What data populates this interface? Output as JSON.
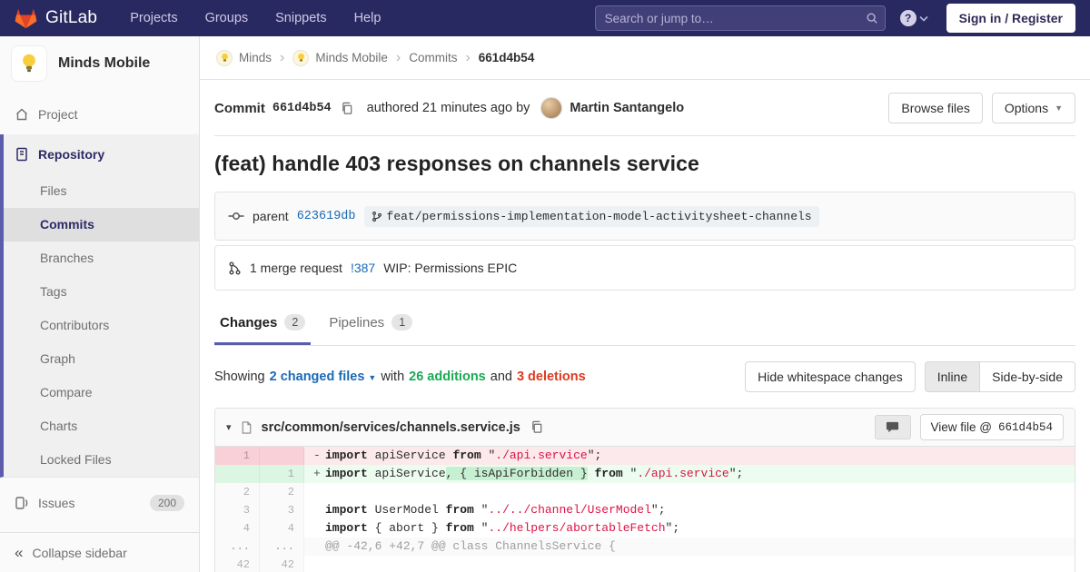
{
  "colors": {
    "navbar_bg": "#292961",
    "logo_orange": "#fc6d26",
    "logo_red": "#e24329",
    "logo_yellow": "#fca326",
    "link_blue": "#1b69b6",
    "additions_green": "#1aaa55",
    "deletions_red": "#db3b21",
    "active_indigo": "#5c5cac",
    "diff_string_red": "#d14",
    "removed_bg": "#fbe9eb",
    "added_bg": "#ecfdf0"
  },
  "navbar": {
    "logo_text": "GitLab",
    "menu": [
      {
        "label": "Projects"
      },
      {
        "label": "Groups"
      },
      {
        "label": "Snippets"
      },
      {
        "label": "Help"
      }
    ],
    "search_placeholder": "Search or jump to…",
    "signin_label": "Sign in / Register"
  },
  "sidebar": {
    "project_name": "Minds Mobile",
    "project_item": "Project",
    "repository_item": "Repository",
    "repository_subitems": [
      {
        "label": "Files"
      },
      {
        "label": "Commits"
      },
      {
        "label": "Branches"
      },
      {
        "label": "Tags"
      },
      {
        "label": "Contributors"
      },
      {
        "label": "Graph"
      },
      {
        "label": "Compare"
      },
      {
        "label": "Charts"
      },
      {
        "label": "Locked Files"
      }
    ],
    "issues_label": "Issues",
    "issues_count": "200",
    "collapse_label": "Collapse sidebar"
  },
  "breadcrumb": {
    "items": [
      {
        "label": "Minds"
      },
      {
        "label": "Minds Mobile"
      },
      {
        "label": "Commits"
      }
    ],
    "current": "661d4b54"
  },
  "commit": {
    "label": "Commit",
    "sha": "661d4b54",
    "authored_text": "authored 21 minutes ago by",
    "author": "Martin Santangelo",
    "browse_files_label": "Browse files",
    "options_label": "Options",
    "title": "(feat) handle 403 responses on channels service",
    "parent_label": "parent",
    "parent_sha": "623619db",
    "parent_branch": "feat/permissions-implementation-model-activitysheet-channels",
    "mr_count_text": "1 merge request",
    "mr_ref": "!387",
    "mr_title": "WIP: Permissions EPIC"
  },
  "tabs": [
    {
      "label": "Changes",
      "count": "2"
    },
    {
      "label": "Pipelines",
      "count": "1"
    }
  ],
  "changes_bar": {
    "showing": "Showing",
    "files_link": "2 changed files",
    "with_word": "with",
    "additions": "26 additions",
    "and_word": "and",
    "deletions": "3 deletions",
    "hide_whitespace_label": "Hide whitespace changes",
    "inline_label": "Inline",
    "side_by_side_label": "Side-by-side"
  },
  "file": {
    "path": "src/common/services/channels.service.js",
    "view_file_label": "View file @",
    "view_file_sha": "661d4b54"
  },
  "diff": {
    "rows": [
      {
        "type": "removed",
        "old": "1",
        "new": "",
        "sign": "-",
        "tokens": [
          {
            "t": "k",
            "v": "import"
          },
          {
            "t": "p",
            "v": " apiService "
          },
          {
            "t": "k",
            "v": "from"
          },
          {
            "t": "p",
            "v": " \""
          },
          {
            "t": "s",
            "v": "./api.service"
          },
          {
            "t": "p",
            "v": "\";"
          }
        ]
      },
      {
        "type": "added",
        "old": "",
        "new": "1",
        "sign": "+",
        "tokens": [
          {
            "t": "k",
            "v": "import"
          },
          {
            "t": "p",
            "v": " apiService"
          },
          {
            "t": "p",
            "v": ", { isApiForbidden }",
            "hl": true
          },
          {
            "t": "p",
            "v": " "
          },
          {
            "t": "k",
            "v": "from"
          },
          {
            "t": "p",
            "v": " \""
          },
          {
            "t": "s",
            "v": "./api.service"
          },
          {
            "t": "p",
            "v": "\";"
          }
        ]
      },
      {
        "type": "context",
        "old": "2",
        "new": "2",
        "sign": "",
        "tokens": []
      },
      {
        "type": "context",
        "old": "3",
        "new": "3",
        "sign": "",
        "tokens": [
          {
            "t": "k",
            "v": "import"
          },
          {
            "t": "p",
            "v": " UserModel "
          },
          {
            "t": "k",
            "v": "from"
          },
          {
            "t": "p",
            "v": " \""
          },
          {
            "t": "s",
            "v": "../../channel/UserModel"
          },
          {
            "t": "p",
            "v": "\";"
          }
        ]
      },
      {
        "type": "context",
        "old": "4",
        "new": "4",
        "sign": "",
        "tokens": [
          {
            "t": "k",
            "v": "import"
          },
          {
            "t": "p",
            "v": " { abort } "
          },
          {
            "t": "k",
            "v": "from"
          },
          {
            "t": "p",
            "v": " \""
          },
          {
            "t": "s",
            "v": "../helpers/abortableFetch"
          },
          {
            "t": "p",
            "v": "\";"
          }
        ]
      },
      {
        "type": "match",
        "old": "...",
        "new": "...",
        "text": "@@ -42,6 +42,7 @@ class ChannelsService {"
      },
      {
        "type": "context",
        "old": "42",
        "new": "42",
        "sign": "",
        "tokens": []
      }
    ]
  }
}
